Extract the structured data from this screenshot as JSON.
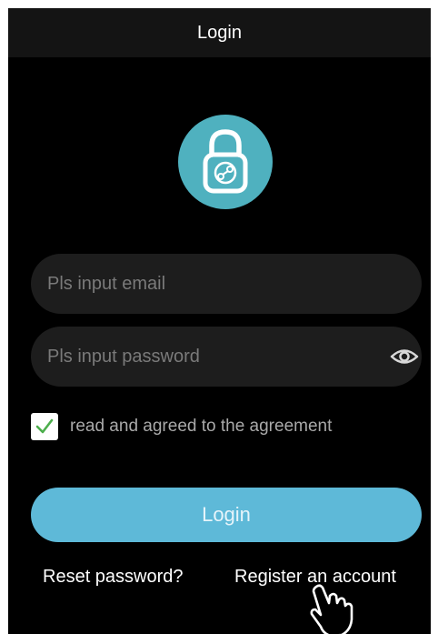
{
  "header": {
    "title": "Login"
  },
  "form": {
    "email_placeholder": "Pls input email",
    "email_value": "",
    "password_placeholder": "Pls input password",
    "password_value": "",
    "agreement_checked": true,
    "agreement_text": "read and agreed to the agreement",
    "login_label": "Login"
  },
  "links": {
    "reset_password": "Reset password?",
    "register": "Register an account"
  },
  "icons": {
    "logo": "padlock-icon",
    "password_toggle": "eye-icon",
    "checkbox_mark": "checkmark-icon",
    "pointer": "hand-pointer-icon"
  },
  "colors": {
    "background": "#000000",
    "titlebar": "#141414",
    "logo_circle": "#4fb1bf",
    "input_background": "#1d1d1d",
    "login_button": "#5eb9d8",
    "checkmark": "#4cae4c"
  }
}
